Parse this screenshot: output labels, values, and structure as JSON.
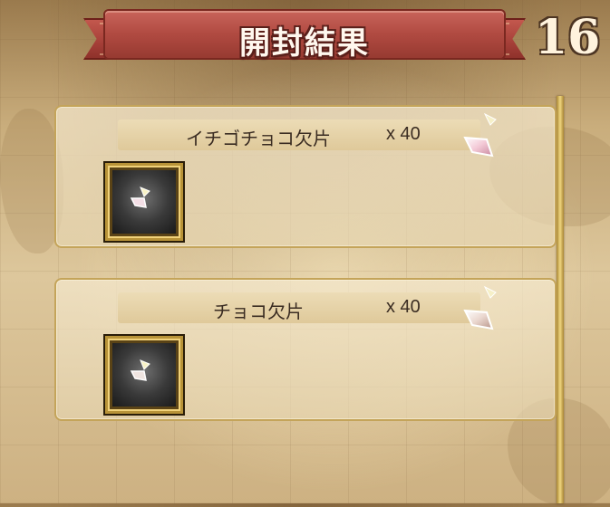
{
  "header": {
    "title": "開封結果",
    "count": "16"
  },
  "results": [
    {
      "name": "イチゴチョコ欠片",
      "quantity": "x 40",
      "icon": "strawberry-chocolate-fragment-gem-icon"
    },
    {
      "name": "チョコ欠片",
      "quantity": "x 40",
      "icon": "chocolate-fragment-gem-icon"
    }
  ],
  "colors": {
    "banner_red": "#b04a41",
    "card_border": "#c4a45a",
    "scrollbar_gold": "#e2c46a",
    "text_dark": "#3a2c22"
  }
}
